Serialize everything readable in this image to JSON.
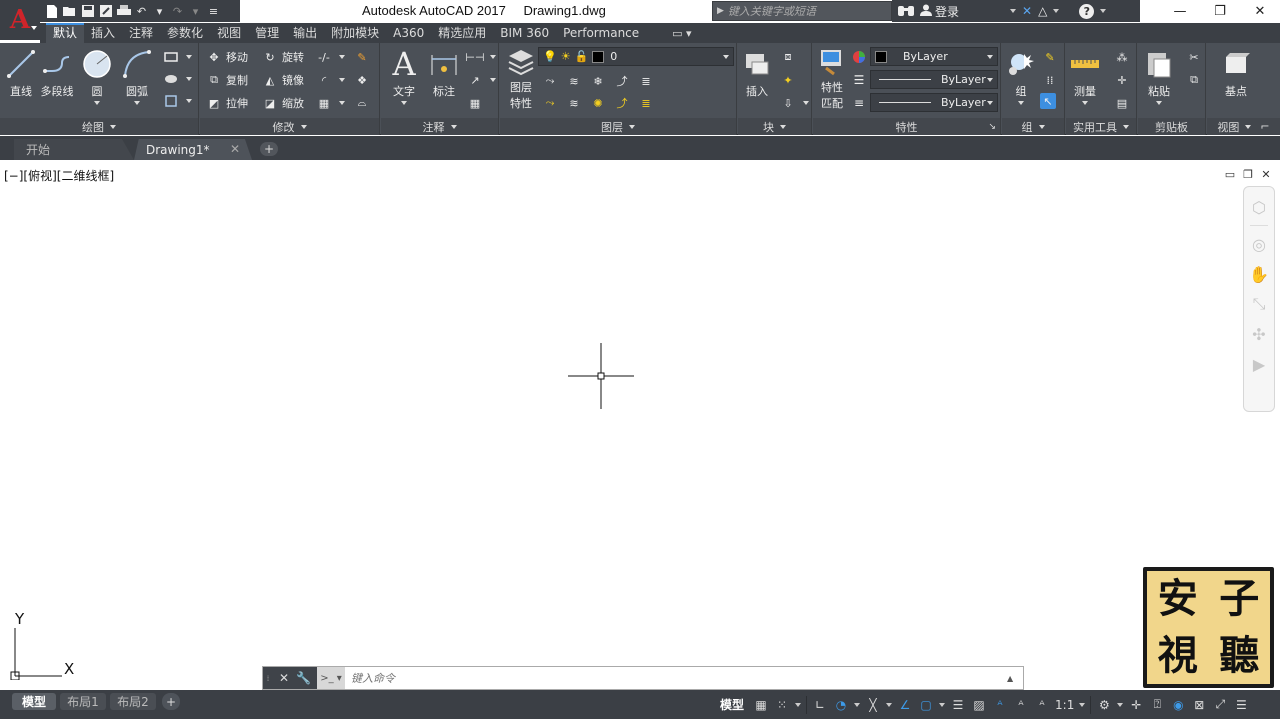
{
  "title_bar": {
    "app_name": "Autodesk AutoCAD 2017",
    "file_name": "Drawing1.dwg",
    "search_placeholder": "键入关键字或短语",
    "login_label": "登录",
    "help_label": "?",
    "logo_letter": "A"
  },
  "ribbon": {
    "tabs": [
      "默认",
      "插入",
      "注释",
      "参数化",
      "视图",
      "管理",
      "输出",
      "附加模块",
      "A360",
      "精选应用",
      "BIM 360",
      "Performance"
    ],
    "active_tab": "默认",
    "panels": {
      "draw": {
        "title": "绘图",
        "tools": [
          "直线",
          "多段线",
          "圆",
          "圆弧"
        ]
      },
      "modify": {
        "title": "修改",
        "tools": [
          "移动",
          "旋转",
          "复制",
          "镜像",
          "拉伸",
          "缩放"
        ]
      },
      "annotation": {
        "title": "注释",
        "tools": [
          "文字",
          "标注"
        ]
      },
      "layers": {
        "title": "图层",
        "tool": "图层特性",
        "tool_line1": "图层",
        "tool_line2": "特性",
        "current_layer": "0"
      },
      "block": {
        "title": "块",
        "tool": "插入"
      },
      "properties": {
        "title": "特性",
        "tool_line1": "特性",
        "tool_line2": "匹配",
        "color": "ByLayer",
        "linetype": "ByLayer",
        "lineweight": "ByLayer"
      },
      "groups": {
        "title": "组",
        "tool": "组"
      },
      "utilities": {
        "title": "实用工具",
        "tool": "测量"
      },
      "clipboard": {
        "title": "剪贴板",
        "tool": "粘贴"
      },
      "view": {
        "title": "视图",
        "tool": "基点"
      }
    }
  },
  "file_tabs": {
    "start": "开始",
    "drawing": "Drawing1*",
    "add": "+"
  },
  "canvas": {
    "viewport_label": "[−][俯视][二维线框]",
    "ucs_x": "X",
    "ucs_y": "Y",
    "stamp_chars": [
      "安",
      "子",
      "視",
      "聽"
    ]
  },
  "command_line": {
    "placeholder": "键入命令"
  },
  "status_bar": {
    "layout_tabs": [
      "模型",
      "布局1",
      "布局2"
    ],
    "model_label": "模型",
    "scale": "1:1",
    "add": "+"
  },
  "colors": {
    "ui_dark": "#3b3f45",
    "ribbon": "#4b5057",
    "accent": "#3d8fe0",
    "logo_red": "#d0242a",
    "stamp_bg": "#f1d68b"
  }
}
